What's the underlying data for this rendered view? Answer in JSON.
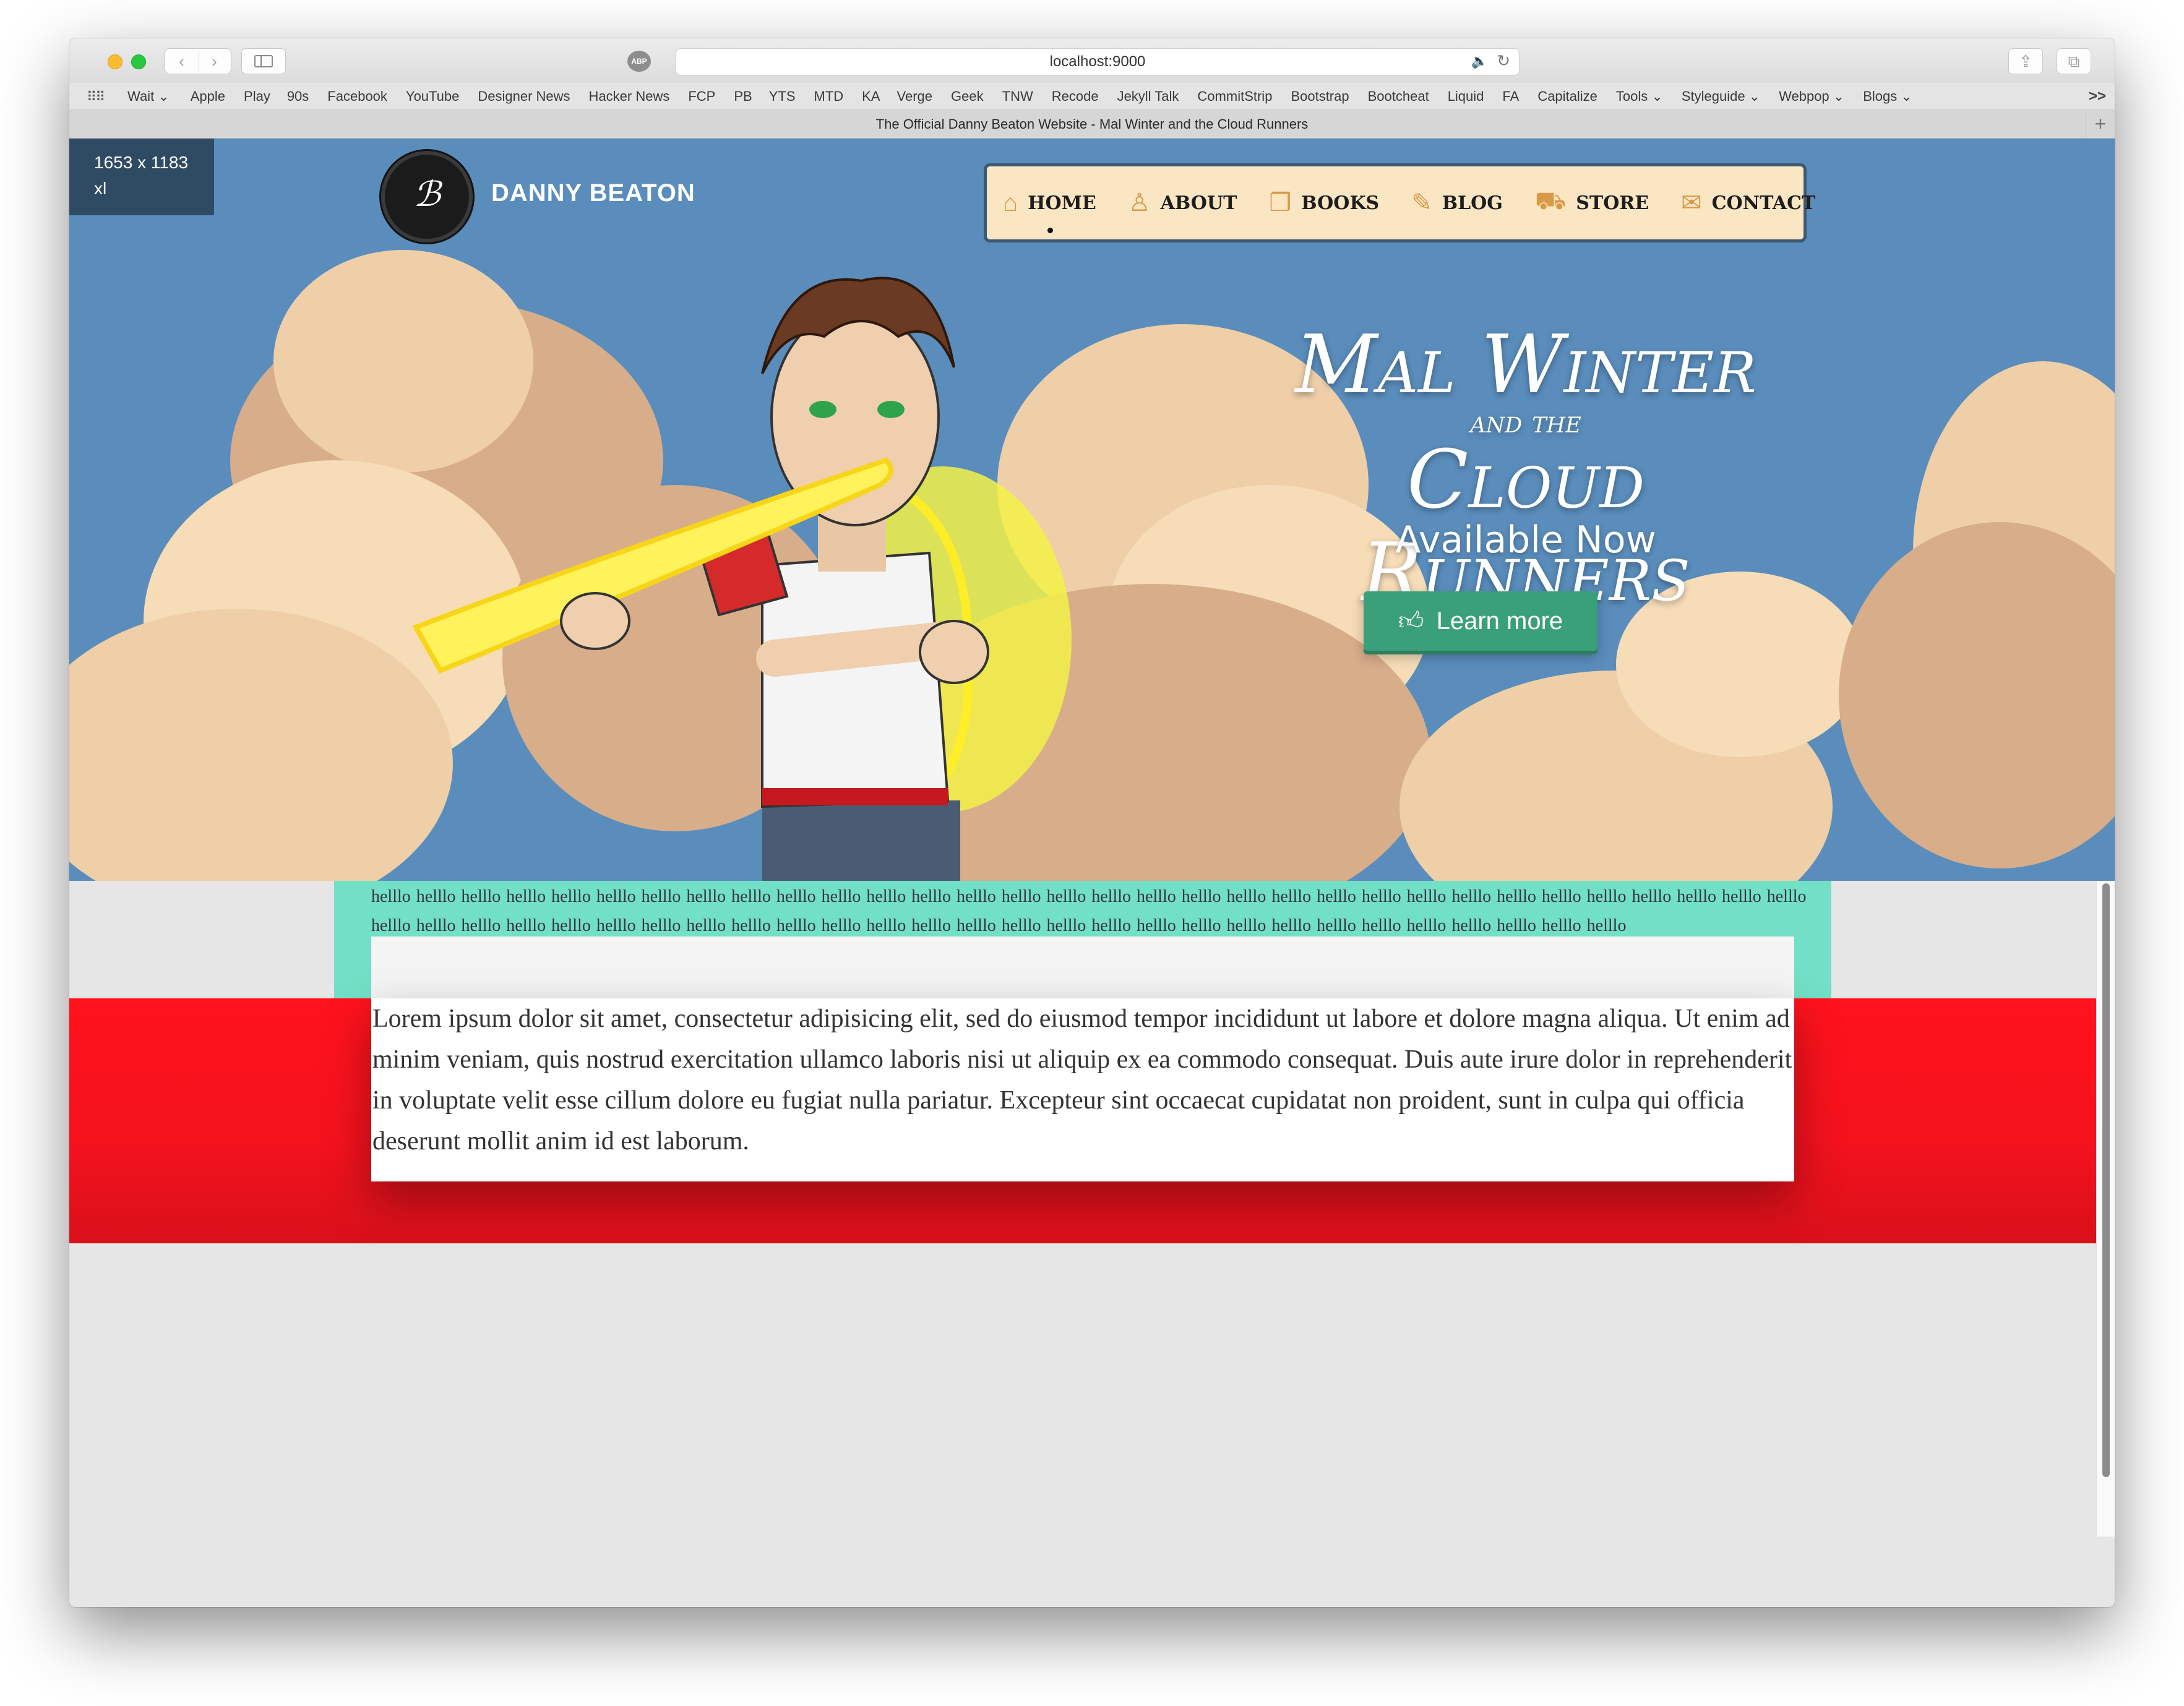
{
  "browser": {
    "url": "localhost:9000",
    "tab_title": "The Official Danny Beaton Website - Mal Winter and the Cloud Runners",
    "abp_label": "ABP",
    "bookmarks": [
      "Wait ⌄",
      "Apple",
      "Play",
      "90s",
      "Facebook",
      "YouTube",
      "Designer News",
      "Hacker News",
      "FCP",
      "PB",
      "YTS",
      "MTD",
      "KA",
      "Verge",
      "Geek",
      "TNW",
      "Recode",
      "Jekyll Talk",
      "CommitStrip",
      "Bootstrap",
      "Bootcheat",
      "Liquid",
      "FA",
      "Capitalize",
      "Tools ⌄",
      "Styleguide ⌄",
      "Webpop ⌄",
      "Blogs ⌄"
    ],
    "bookmarks_overflow": ">>"
  },
  "badge": {
    "size": "1653 x 1183",
    "breakpoint": "xl"
  },
  "site": {
    "brand": "DANNY BEATON",
    "nav": [
      {
        "label": "HOME",
        "icon": "home-icon"
      },
      {
        "label": "ABOUT",
        "icon": "person-icon"
      },
      {
        "label": "BOOKS",
        "icon": "book-icon"
      },
      {
        "label": "BLOG",
        "icon": "pen-icon"
      },
      {
        "label": "STORE",
        "icon": "cart-icon"
      },
      {
        "label": "CONTACT",
        "icon": "envelope-icon"
      }
    ],
    "active_nav": "HOME"
  },
  "hero": {
    "title_line1": "Mal Winter",
    "title_line2": "and the",
    "title_line3": "Cloud Runners",
    "subtitle": "Available Now",
    "cta": "Learn more",
    "cta_icon": "thumbs-up-icon"
  },
  "content": {
    "hello_text": "helllo helllo helllo helllo helllo helllo helllo helllo helllo helllo helllo helllo helllo helllo helllo helllo helllo helllo helllo helllo helllo helllo helllo helllo helllo helllo helllo helllo helllo helllo helllo helllo helllo helllo helllo helllo helllo helllo helllo helllo helllo helllo helllo helllo helllo helllo helllo helllo helllo helllo helllo helllo helllo helllo helllo helllo helllo helllo helllo helllo",
    "lorem": "Lorem ipsum dolor sit amet, consectetur adipisicing elit, sed do eiusmod tempor incididunt ut labore et dolore magna aliqua. Ut enim ad minim veniam, quis nostrud exercitation ullamco laboris nisi ut aliquip ex ea commodo consequat. Duis aute irure dolor in reprehenderit in voluptate velit esse cillum dolore eu fugiat nulla pariatur. Excepteur sint occaecat cupidatat non proident, sunt in culpa qui officia deserunt mollit anim id est laborum."
  },
  "colors": {
    "sky": "#5a8dbc",
    "nav_bg": "#fbe6c4",
    "cta": "#3aa07a",
    "teal": "#72e0c6",
    "red": "#ff121c"
  }
}
